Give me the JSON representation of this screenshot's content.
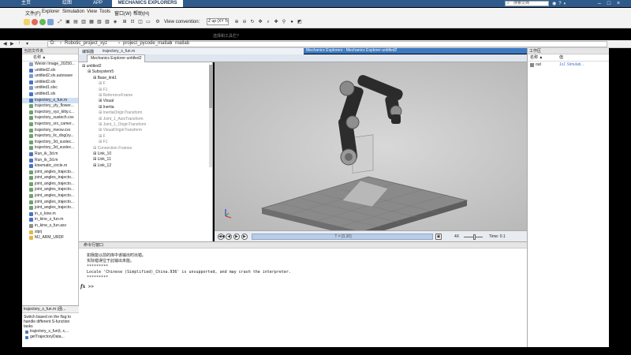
{
  "top_tabs": [
    {
      "label": "主页",
      "active": false
    },
    {
      "label": "绘图",
      "active": false
    },
    {
      "label": "APP",
      "active": false
    },
    {
      "label": "MECHANICS EXPLORERS",
      "active": true
    }
  ],
  "search_placeholder": "搜索文档",
  "menu": [
    "文件(F)",
    "Explorer",
    "Simulation",
    "View",
    "Tools",
    "窗口(W)",
    "帮助(H)"
  ],
  "toolbar": {
    "view_convention_label": "View convention:",
    "view_convention_value": "Z up (XY Top)",
    "quick_access": "选择和工具栏?"
  },
  "address": {
    "path": [
      "D:",
      "Robotic_project_xyz",
      "project_pycode_matlab",
      "matlab"
    ]
  },
  "left_panel": {
    "title": "当前文件夹",
    "column_header": "名称 ▲",
    "files": [
      {
        "name": "Weixin Image_20250...",
        "icon": "image-icon",
        "color": "#8aa4c7"
      },
      {
        "name": "untitled2.slx",
        "icon": "simulink-icon",
        "color": "#4a74c4"
      },
      {
        "name": "untitled2.slx.autosave",
        "icon": "simulink-icon",
        "color": "#7f9bc4"
      },
      {
        "name": "untitled2.slx",
        "icon": "simulink-icon",
        "color": "#4a74c4"
      },
      {
        "name": "untitled1.slxc",
        "icon": "simulink-icon",
        "color": "#7f9bc4"
      },
      {
        "name": "untitled1.slx",
        "icon": "simulink-icon",
        "color": "#4a74c4"
      },
      {
        "name": "trajectory_s_fun.m",
        "icon": "m-file-icon",
        "color": "#4a74c4",
        "selected": true
      },
      {
        "name": "trajectory_yty_flower...",
        "icon": "data-icon",
        "color": "#6fa36f"
      },
      {
        "name": "trajectory_xyz_kitty.c...",
        "icon": "data-icon",
        "color": "#6fa36f"
      },
      {
        "name": "trajectory_sustech.csv",
        "icon": "data-icon",
        "color": "#6fa36f"
      },
      {
        "name": "trajectory_srx_camer...",
        "icon": "data-icon",
        "color": "#6fa36f"
      },
      {
        "name": "trajectory_meow.csv",
        "icon": "data-icon",
        "color": "#6fa36f"
      },
      {
        "name": "trajectory_lic_dog(sy...",
        "icon": "data-icon",
        "color": "#6fa36f"
      },
      {
        "name": "trajectory_3d_sustec...",
        "icon": "data-icon",
        "color": "#6fa36f"
      },
      {
        "name": "trajectory_3d_sustec...",
        "icon": "data-icon",
        "color": "#6fa36f"
      },
      {
        "name": "Run_ik_3d.m",
        "icon": "m-file-icon",
        "color": "#4a74c4"
      },
      {
        "name": "Run_ik_2d.m",
        "icon": "m-file-icon",
        "color": "#4a74c4"
      },
      {
        "name": "kinematic_circle.m",
        "icon": "m-file-icon",
        "color": "#4a74c4"
      },
      {
        "name": "joint_angles_trajecto...",
        "icon": "data-icon",
        "color": "#6fa36f"
      },
      {
        "name": "joint_angles_trajecto...",
        "icon": "data-icon",
        "color": "#6fa36f"
      },
      {
        "name": "joint_angles_trajecto...",
        "icon": "data-icon",
        "color": "#6fa36f"
      },
      {
        "name": "joint_angles_trajecto...",
        "icon": "data-icon",
        "color": "#6fa36f"
      },
      {
        "name": "joint_angles_trajecto...",
        "icon": "data-icon",
        "color": "#6fa36f"
      },
      {
        "name": "joint_angles_trajecto...",
        "icon": "data-icon",
        "color": "#6fa36f"
      },
      {
        "name": "joint_angles_trajecto...",
        "icon": "data-icon",
        "color": "#6fa36f"
      },
      {
        "name": "in_x_kine.m",
        "icon": "m-file-icon",
        "color": "#4a74c4"
      },
      {
        "name": "in_kine_s_fun.m",
        "icon": "m-file-icon",
        "color": "#4a74c4"
      },
      {
        "name": "in_kine_s_fun.asv",
        "icon": "m-file-icon",
        "color": "#8f8f8f"
      },
      {
        "name": "slprj",
        "icon": "folder-icon",
        "color": "#e0b84a"
      },
      {
        "name": "MJ_ARM_URDF",
        "icon": "folder-icon",
        "color": "#e0b84a"
      }
    ],
    "details_tab": "trajectory_s_fun.m (函...",
    "details_text": "Switch based on the flag to handle different S-function tasks",
    "details_functions": [
      "trajectory_s_fun(t, x,...",
      "getTrajectoryData..."
    ]
  },
  "editor": {
    "tab_left": "编辑器",
    "tab_file": "trajectory_s_fun.m"
  },
  "mechanics": {
    "window_title": "Mechanics Explorers - Mechanics Explorer-untitled2",
    "tab": "Mechanics Explorer-untitled2",
    "tree": [
      {
        "label": "untitled2",
        "indent": 0,
        "grey": false
      },
      {
        "label": "Subsystem5",
        "indent": 1,
        "grey": false
      },
      {
        "label": "Base_link1",
        "indent": 2,
        "grey": false
      },
      {
        "label": "F",
        "indent": 3,
        "grey": true
      },
      {
        "label": "F1",
        "indent": 3,
        "grey": true
      },
      {
        "label": "ReferenceFrame",
        "indent": 3,
        "grey": true
      },
      {
        "label": "Visual",
        "indent": 3,
        "grey": false
      },
      {
        "label": "Inertia",
        "indent": 3,
        "grey": false
      },
      {
        "label": "InertiaOriginTransform",
        "indent": 3,
        "grey": true
      },
      {
        "label": "Joint_1_AxisTransform",
        "indent": 3,
        "grey": true
      },
      {
        "label": "Joint_1_OriginTransform",
        "indent": 3,
        "grey": true
      },
      {
        "label": "VisualOriginTransform",
        "indent": 3,
        "grey": true
      },
      {
        "label": "F",
        "indent": 3,
        "grey": true
      },
      {
        "label": "F1",
        "indent": 3,
        "grey": true
      },
      {
        "label": "Connection Frames",
        "indent": 2,
        "grey": true
      },
      {
        "label": "Link_10",
        "indent": 2,
        "grey": false
      },
      {
        "label": "Link_11",
        "indent": 2,
        "grey": false
      },
      {
        "label": "Link_12",
        "indent": 2,
        "grey": false
      }
    ],
    "playback": {
      "timeline_text": "T = [0,30]",
      "speed": "4X",
      "time_label": "Time: 0.1"
    }
  },
  "command_window": {
    "title": "命令行窗口",
    "lines": [
      "如我能以前的库中该输出时出错。",
      "实际错误位于此输出未能。",
      "*********",
      "Locale 'Chinese (Simplified)_China.936' is unsupported, and may crash the interpreter.",
      "*********"
    ],
    "prompt": ">>"
  },
  "workspace": {
    "title": "工作区",
    "col_name": "名称 ▲",
    "col_value": "值",
    "rows": [
      {
        "name": "out",
        "value": "1x1 Simulati..."
      }
    ]
  },
  "colors": {
    "top_bar": "#2f5b8c",
    "title_bar": "#3b79c2",
    "robot_dark": "#2a2a2a",
    "robot_grey": "#8c8c8c"
  }
}
